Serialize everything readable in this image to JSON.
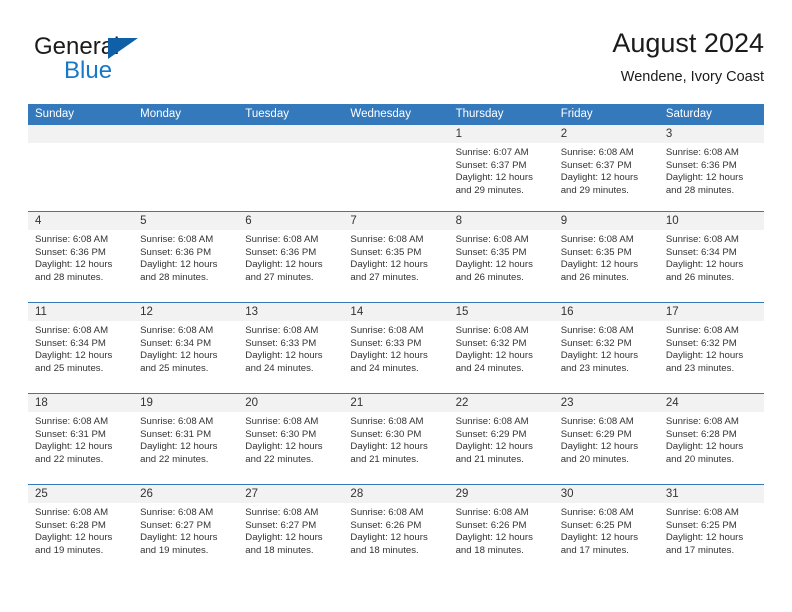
{
  "brand": {
    "general": "General",
    "blue": "Blue",
    "flag_icon": "triangle-flag-icon",
    "accent_color": "#1878c8",
    "flag_color": "#1060a8"
  },
  "header": {
    "title": "August 2024",
    "subtitle": "Wendene, Ivory Coast"
  },
  "calendar": {
    "header_bg": "#3579bd",
    "daynum_bg": "#f2f2f2",
    "weekdays": [
      "Sunday",
      "Monday",
      "Tuesday",
      "Wednesday",
      "Thursday",
      "Friday",
      "Saturday"
    ],
    "weeks": [
      [
        {
          "day": "",
          "sunrise": "",
          "sunset": "",
          "daylight": "",
          "empty": true
        },
        {
          "day": "",
          "sunrise": "",
          "sunset": "",
          "daylight": "",
          "empty": true
        },
        {
          "day": "",
          "sunrise": "",
          "sunset": "",
          "daylight": "",
          "empty": true
        },
        {
          "day": "",
          "sunrise": "",
          "sunset": "",
          "daylight": "",
          "empty": true
        },
        {
          "day": "1",
          "sunrise": "Sunrise: 6:07 AM",
          "sunset": "Sunset: 6:37 PM",
          "daylight": "Daylight: 12 hours and 29 minutes."
        },
        {
          "day": "2",
          "sunrise": "Sunrise: 6:08 AM",
          "sunset": "Sunset: 6:37 PM",
          "daylight": "Daylight: 12 hours and 29 minutes."
        },
        {
          "day": "3",
          "sunrise": "Sunrise: 6:08 AM",
          "sunset": "Sunset: 6:36 PM",
          "daylight": "Daylight: 12 hours and 28 minutes."
        }
      ],
      [
        {
          "day": "4",
          "sunrise": "Sunrise: 6:08 AM",
          "sunset": "Sunset: 6:36 PM",
          "daylight": "Daylight: 12 hours and 28 minutes."
        },
        {
          "day": "5",
          "sunrise": "Sunrise: 6:08 AM",
          "sunset": "Sunset: 6:36 PM",
          "daylight": "Daylight: 12 hours and 28 minutes."
        },
        {
          "day": "6",
          "sunrise": "Sunrise: 6:08 AM",
          "sunset": "Sunset: 6:36 PM",
          "daylight": "Daylight: 12 hours and 27 minutes."
        },
        {
          "day": "7",
          "sunrise": "Sunrise: 6:08 AM",
          "sunset": "Sunset: 6:35 PM",
          "daylight": "Daylight: 12 hours and 27 minutes."
        },
        {
          "day": "8",
          "sunrise": "Sunrise: 6:08 AM",
          "sunset": "Sunset: 6:35 PM",
          "daylight": "Daylight: 12 hours and 26 minutes."
        },
        {
          "day": "9",
          "sunrise": "Sunrise: 6:08 AM",
          "sunset": "Sunset: 6:35 PM",
          "daylight": "Daylight: 12 hours and 26 minutes."
        },
        {
          "day": "10",
          "sunrise": "Sunrise: 6:08 AM",
          "sunset": "Sunset: 6:34 PM",
          "daylight": "Daylight: 12 hours and 26 minutes."
        }
      ],
      [
        {
          "day": "11",
          "sunrise": "Sunrise: 6:08 AM",
          "sunset": "Sunset: 6:34 PM",
          "daylight": "Daylight: 12 hours and 25 minutes."
        },
        {
          "day": "12",
          "sunrise": "Sunrise: 6:08 AM",
          "sunset": "Sunset: 6:34 PM",
          "daylight": "Daylight: 12 hours and 25 minutes."
        },
        {
          "day": "13",
          "sunrise": "Sunrise: 6:08 AM",
          "sunset": "Sunset: 6:33 PM",
          "daylight": "Daylight: 12 hours and 24 minutes."
        },
        {
          "day": "14",
          "sunrise": "Sunrise: 6:08 AM",
          "sunset": "Sunset: 6:33 PM",
          "daylight": "Daylight: 12 hours and 24 minutes."
        },
        {
          "day": "15",
          "sunrise": "Sunrise: 6:08 AM",
          "sunset": "Sunset: 6:32 PM",
          "daylight": "Daylight: 12 hours and 24 minutes."
        },
        {
          "day": "16",
          "sunrise": "Sunrise: 6:08 AM",
          "sunset": "Sunset: 6:32 PM",
          "daylight": "Daylight: 12 hours and 23 minutes."
        },
        {
          "day": "17",
          "sunrise": "Sunrise: 6:08 AM",
          "sunset": "Sunset: 6:32 PM",
          "daylight": "Daylight: 12 hours and 23 minutes."
        }
      ],
      [
        {
          "day": "18",
          "sunrise": "Sunrise: 6:08 AM",
          "sunset": "Sunset: 6:31 PM",
          "daylight": "Daylight: 12 hours and 22 minutes."
        },
        {
          "day": "19",
          "sunrise": "Sunrise: 6:08 AM",
          "sunset": "Sunset: 6:31 PM",
          "daylight": "Daylight: 12 hours and 22 minutes."
        },
        {
          "day": "20",
          "sunrise": "Sunrise: 6:08 AM",
          "sunset": "Sunset: 6:30 PM",
          "daylight": "Daylight: 12 hours and 22 minutes."
        },
        {
          "day": "21",
          "sunrise": "Sunrise: 6:08 AM",
          "sunset": "Sunset: 6:30 PM",
          "daylight": "Daylight: 12 hours and 21 minutes."
        },
        {
          "day": "22",
          "sunrise": "Sunrise: 6:08 AM",
          "sunset": "Sunset: 6:29 PM",
          "daylight": "Daylight: 12 hours and 21 minutes."
        },
        {
          "day": "23",
          "sunrise": "Sunrise: 6:08 AM",
          "sunset": "Sunset: 6:29 PM",
          "daylight": "Daylight: 12 hours and 20 minutes."
        },
        {
          "day": "24",
          "sunrise": "Sunrise: 6:08 AM",
          "sunset": "Sunset: 6:28 PM",
          "daylight": "Daylight: 12 hours and 20 minutes."
        }
      ],
      [
        {
          "day": "25",
          "sunrise": "Sunrise: 6:08 AM",
          "sunset": "Sunset: 6:28 PM",
          "daylight": "Daylight: 12 hours and 19 minutes."
        },
        {
          "day": "26",
          "sunrise": "Sunrise: 6:08 AM",
          "sunset": "Sunset: 6:27 PM",
          "daylight": "Daylight: 12 hours and 19 minutes."
        },
        {
          "day": "27",
          "sunrise": "Sunrise: 6:08 AM",
          "sunset": "Sunset: 6:27 PM",
          "daylight": "Daylight: 12 hours and 18 minutes."
        },
        {
          "day": "28",
          "sunrise": "Sunrise: 6:08 AM",
          "sunset": "Sunset: 6:26 PM",
          "daylight": "Daylight: 12 hours and 18 minutes."
        },
        {
          "day": "29",
          "sunrise": "Sunrise: 6:08 AM",
          "sunset": "Sunset: 6:26 PM",
          "daylight": "Daylight: 12 hours and 18 minutes."
        },
        {
          "day": "30",
          "sunrise": "Sunrise: 6:08 AM",
          "sunset": "Sunset: 6:25 PM",
          "daylight": "Daylight: 12 hours and 17 minutes."
        },
        {
          "day": "31",
          "sunrise": "Sunrise: 6:08 AM",
          "sunset": "Sunset: 6:25 PM",
          "daylight": "Daylight: 12 hours and 17 minutes."
        }
      ]
    ]
  }
}
